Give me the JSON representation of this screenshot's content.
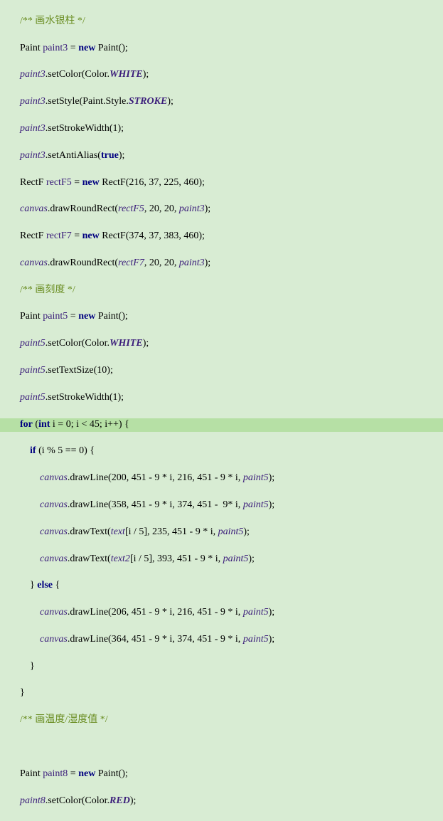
{
  "code": {
    "c1": "/** 画水银柱 */",
    "l2a": "Paint ",
    "l2b": "paint3",
    "l2c": " = ",
    "l2d": "new",
    "l2e": " Paint();",
    "l3a": "paint3",
    "l3b": ".setColor(Color.",
    "l3c": "WHITE",
    "l3d": ");",
    "l4a": "paint3",
    "l4b": ".setStyle(Paint.Style.",
    "l4c": "STROKE",
    "l4d": ");",
    "l5a": "paint3",
    "l5b": ".setStrokeWidth(1);",
    "l6a": "paint3",
    "l6b": ".setAntiAlias(",
    "l6c": "true",
    "l6d": ");",
    "l7a": "RectF ",
    "l7b": "rectF5",
    "l7c": " = ",
    "l7d": "new",
    "l7e": " RectF(216, 37, 225, 460);",
    "l8a": "canvas",
    "l8b": ".drawRoundRect(",
    "l8c": "rectF5",
    "l8d": ", 20, 20, ",
    "l8e": "paint3",
    "l8f": ");",
    "l9a": "RectF ",
    "l9b": "rectF7",
    "l9c": " = ",
    "l9d": "new",
    "l9e": " RectF(374, 37, 383, 460);",
    "l10a": "canvas",
    "l10b": ".drawRoundRect(",
    "l10c": "rectF7",
    "l10d": ", 20, 20, ",
    "l10e": "paint3",
    "l10f": ");",
    "c2": "/** 画刻度 */",
    "l12a": "Paint ",
    "l12b": "paint5",
    "l12c": " = ",
    "l12d": "new",
    "l12e": " Paint();",
    "l13a": "paint5",
    "l13b": ".setColor(Color.",
    "l13c": "WHITE",
    "l13d": ");",
    "l14a": "paint5",
    "l14b": ".setTextSize(10);",
    "l15a": "paint5",
    "l15b": ".setStrokeWidth(1);",
    "l16a": "for",
    "l16b": " (",
    "l16c": "int",
    "l16d": " i = 0; i < 45; i++) {",
    "l17a": "if",
    "l17b": " (i % 5 == 0) {",
    "l18a": "canvas",
    "l18b": ".drawLine(200, 451 - 9 * i, 216, 451 - 9 * i, ",
    "l18c": "paint5",
    "l18d": ");",
    "l19a": "canvas",
    "l19b": ".drawLine(358, 451 - 9 * i, 374, 451 -  9* i, ",
    "l19c": "paint5",
    "l19d": ");",
    "l20a": "canvas",
    "l20b": ".drawText(",
    "l20c": "text",
    "l20d": "[i / 5], 235, 451 - 9 * i, ",
    "l20e": "paint5",
    "l20f": ");",
    "l21a": "canvas",
    "l21b": ".drawText(",
    "l21c": "text2",
    "l21d": "[i / 5], 393, 451 - 9 * i, ",
    "l21e": "paint5",
    "l21f": ");",
    "l22a": "} ",
    "l22b": "else",
    "l22c": " {",
    "l23a": "canvas",
    "l23b": ".drawLine(206, 451 - 9 * i, 216, 451 - 9 * i, ",
    "l23c": "paint5",
    "l23d": ");",
    "l24a": "canvas",
    "l24b": ".drawLine(364, 451 - 9 * i, 374, 451 - 9 * i, ",
    "l24c": "paint5",
    "l24d": ");",
    "l25": "}",
    "l26": "}",
    "c3": "/** 画温度/湿度值 */",
    "blank": "",
    "l28a": "Paint ",
    "l28b": "paint8",
    "l28c": " = ",
    "l28d": "new",
    "l28e": " Paint();",
    "l29a": "paint8",
    "l29b": ".setColor(Color.",
    "l29c": "RED",
    "l29d": ");"
  }
}
